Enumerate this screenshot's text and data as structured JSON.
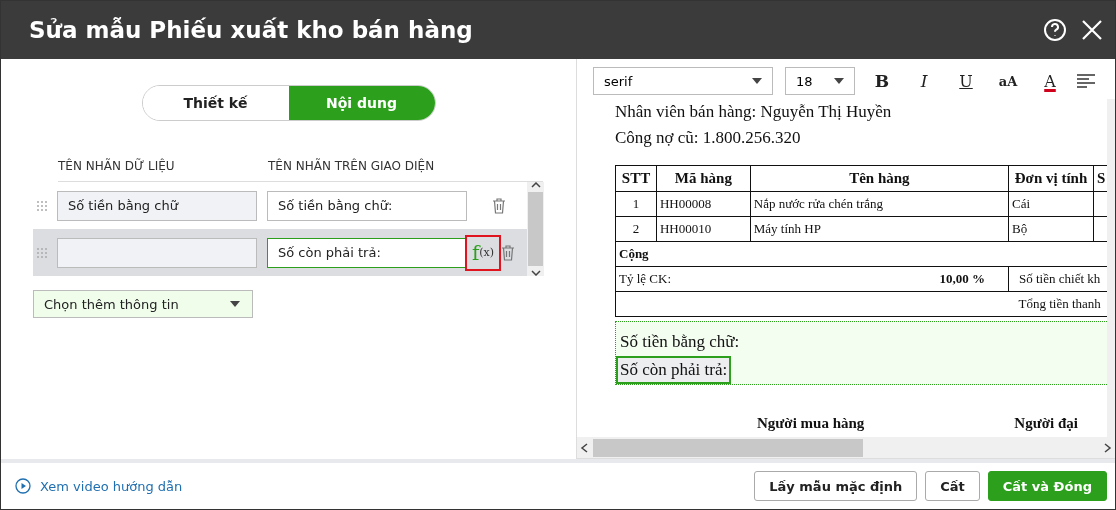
{
  "window": {
    "title": "Sửa mẫu Phiếu xuất kho bán hàng"
  },
  "editor": {
    "tabs": [
      {
        "label": "Thiết kế",
        "selected": false
      },
      {
        "label": "Nội dung",
        "selected": true
      }
    ],
    "columns": [
      "TÊN NHÃN DỮ LIỆU",
      "TÊN NHÃN TRÊN GIAO DIỆN"
    ],
    "rows": [
      {
        "data_label": "Số tiền bằng chữ",
        "display_label": "Số tiền bằng chữ:",
        "selected": false
      },
      {
        "data_label": "",
        "display_label": "Số còn phải trả:",
        "selected": true,
        "formula": "f",
        "formula_sub": "(x)"
      }
    ],
    "add_dropdown": {
      "value": "Chọn thêm thông tin"
    }
  },
  "preview": {
    "toolbar": {
      "font": "serif",
      "size": "18",
      "buttons": [
        {
          "kind": "bold",
          "label": "B"
        },
        {
          "kind": "italic",
          "label": "I"
        },
        {
          "kind": "underline",
          "label": "U"
        },
        {
          "kind": "case",
          "label": "aA"
        },
        {
          "kind": "color",
          "label": "A"
        }
      ]
    },
    "lines": [
      "Nhân viên bán hàng: Nguyễn Thị Huyền",
      "Công nợ cũ: 1.800.256.320"
    ],
    "table": {
      "columns": [
        "STT",
        "Mã hàng",
        "Tên hàng",
        "Đơn vị tính",
        "S"
      ],
      "rows": [
        [
          "1",
          "HH00008",
          "Nắp nước rửa chén trắng",
          "Cái",
          ""
        ],
        [
          "2",
          "HH00010",
          "Máy tính HP",
          "Bộ",
          ""
        ]
      ],
      "total_label": "Cộng",
      "discount_label": "Tỷ lệ CK:",
      "discount_value": "10,00 %",
      "discount_amount_label": "Số tiền chiết kh",
      "grand_total_label": "Tổng tiền thanh"
    },
    "summary": [
      {
        "text": "Số tiền bằng chữ:",
        "selected": false
      },
      {
        "text": "Số còn phải trả:",
        "selected": true
      }
    ],
    "signatures": [
      "Người mua hàng",
      "Người đại"
    ]
  },
  "footer": {
    "link": "Xem video hướng dẫn",
    "buttons": [
      {
        "label": "Lấy mẫu mặc định",
        "kind": "default"
      },
      {
        "label": "Cất",
        "kind": "default"
      },
      {
        "label": "Cất và Đóng",
        "kind": "primary"
      }
    ]
  }
}
